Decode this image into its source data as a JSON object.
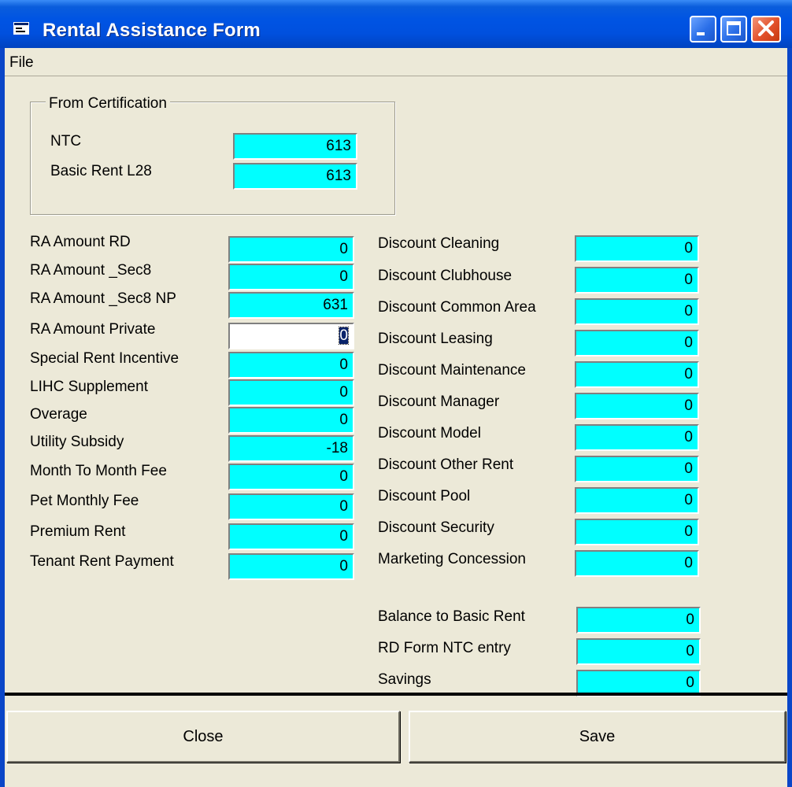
{
  "window": {
    "title": "Rental Assistance Form"
  },
  "menu": {
    "file": "File"
  },
  "certification": {
    "title": "From Certification",
    "ntc_label": "NTC",
    "ntc_value": "613",
    "basic_rent_label": "Basic Rent L28",
    "basic_rent_value": "613"
  },
  "left_fields": [
    {
      "label": "RA Amount RD",
      "value": "0"
    },
    {
      "label": "RA Amount _Sec8",
      "value": "0"
    },
    {
      "label": "RA Amount _Sec8 NP",
      "value": "631"
    },
    {
      "label": "RA Amount Private",
      "value": "0"
    },
    {
      "label": "Special Rent Incentive",
      "value": "0"
    },
    {
      "label": "LIHC Supplement",
      "value": "0"
    },
    {
      "label": "Overage",
      "value": "0"
    },
    {
      "label": "Utility Subsidy",
      "value": "-18"
    },
    {
      "label": "Month To Month Fee",
      "value": "0"
    },
    {
      "label": "Pet Monthly Fee",
      "value": "0"
    },
    {
      "label": "Premium Rent",
      "value": "0"
    },
    {
      "label": "Tenant Rent Payment",
      "value": "0"
    }
  ],
  "right_fields": [
    {
      "label": "Discount Cleaning",
      "value": "0"
    },
    {
      "label": "Discount Clubhouse",
      "value": "0"
    },
    {
      "label": "Discount Common Area",
      "value": "0"
    },
    {
      "label": "Discount Leasing",
      "value": "0"
    },
    {
      "label": "Discount Maintenance",
      "value": "0"
    },
    {
      "label": "Discount Manager",
      "value": "0"
    },
    {
      "label": "Discount Model",
      "value": "0"
    },
    {
      "label": "Discount Other Rent",
      "value": "0"
    },
    {
      "label": "Discount Pool",
      "value": "0"
    },
    {
      "label": "Discount Security",
      "value": "0"
    },
    {
      "label": "Marketing Concession",
      "value": "0"
    }
  ],
  "summary_fields": [
    {
      "label": "Balance to Basic Rent",
      "value": "0"
    },
    {
      "label": "RD Form NTC entry",
      "value": "0"
    },
    {
      "label": "Savings",
      "value": "0"
    }
  ],
  "buttons": {
    "close": "Close",
    "save": "Save"
  },
  "colors": {
    "field_bg": "#00ffff",
    "titlebar": "#0054e3",
    "face": "#ece9d8"
  }
}
